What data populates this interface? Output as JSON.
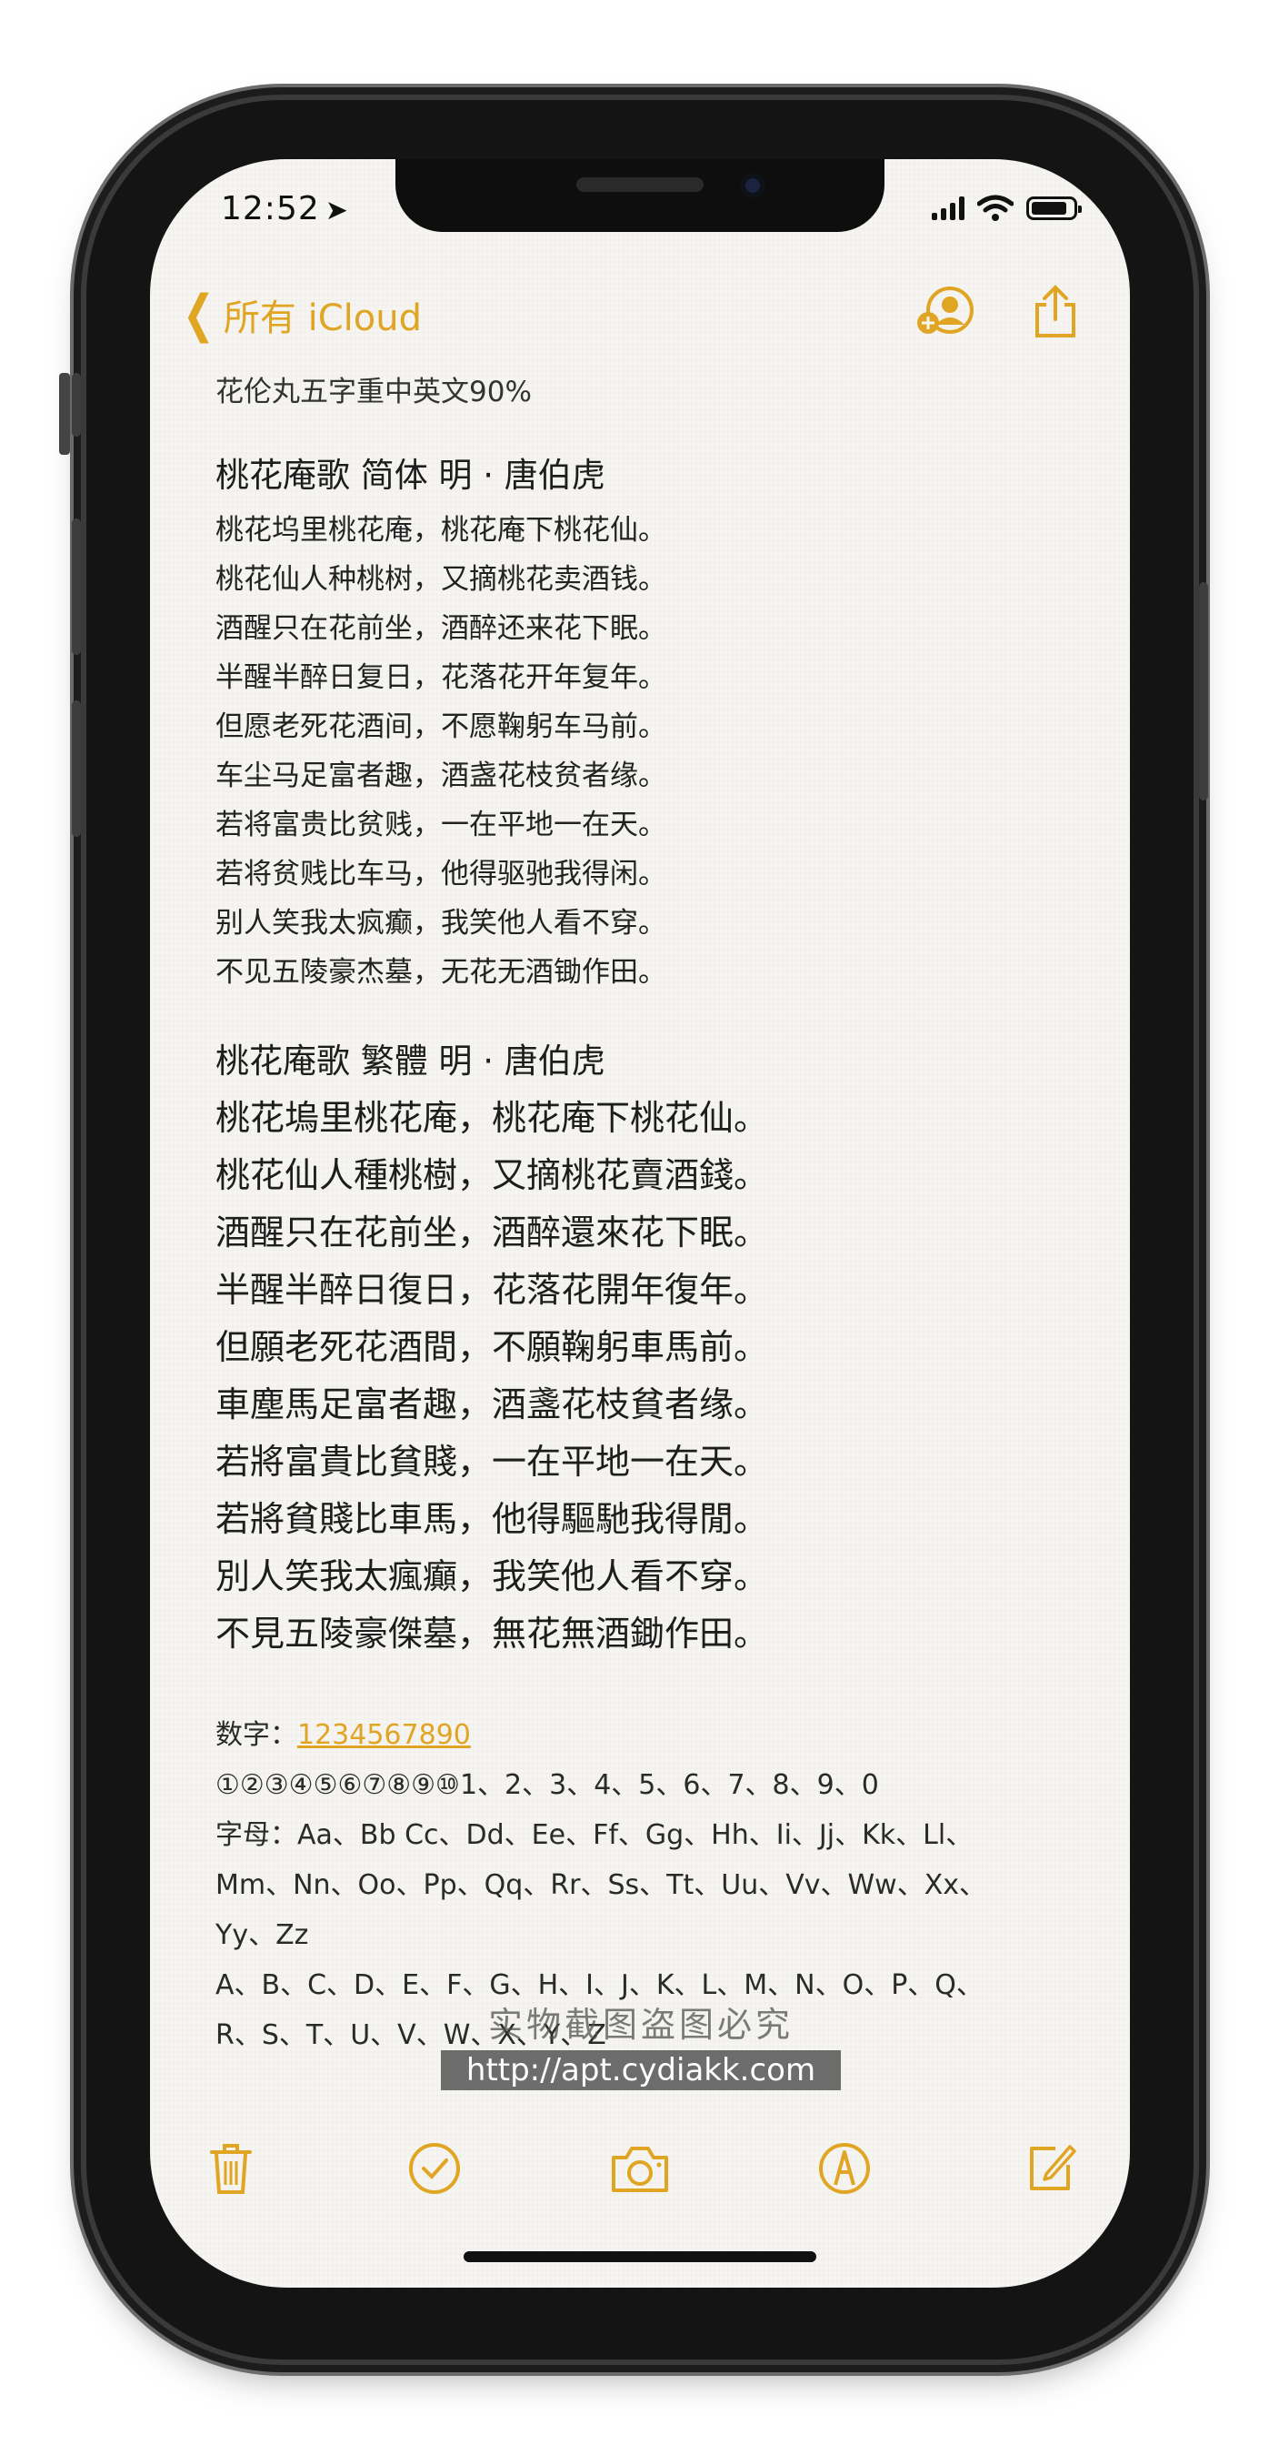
{
  "status_bar": {
    "time": "12:52",
    "location_arrow": "location-arrow-icon"
  },
  "nav": {
    "back_label": "所有 iCloud",
    "icons": [
      "add-person-icon",
      "share-icon"
    ]
  },
  "note": {
    "subtitle": "花伦丸五字重中英文90%",
    "poem_simplified": {
      "title": "桃花庵歌  简体   明 · 唐伯虎",
      "lines": [
        "桃花坞里桃花庵，桃花庵下桃花仙。",
        "桃花仙人种桃树，又摘桃花卖酒钱。",
        "酒醒只在花前坐，酒醉还来花下眠。",
        "半醒半醉日复日，花落花开年复年。",
        "但愿老死花酒间，不愿鞠躬车马前。",
        "车尘马足富者趣，酒盏花枝贫者缘。",
        "若将富贵比贫贱，一在平地一在天。",
        "若将贫贱比车马，他得驱驰我得闲。",
        "别人笑我太疯癫，我笑他人看不穿。",
        "不见五陵豪杰墓，无花无酒锄作田。"
      ]
    },
    "poem_traditional": {
      "title": "桃花庵歌  繁體      明 · 唐伯虎",
      "lines": [
        "桃花塢里桃花庵，桃花庵下桃花仙。",
        "桃花仙人種桃樹，又摘桃花賣酒錢。",
        "酒醒只在花前坐，酒醉還來花下眠。",
        "半醒半醉日復日，花落花開年復年。",
        "但願老死花酒間，不願鞠躬車馬前。",
        "車塵馬足富者趣，酒盞花枝貧者缘。",
        "若將富貴比貧賤，一在平地一在天。",
        "若將貧賤比車馬，他得驅馳我得閒。",
        "別人笑我太瘋癲，我笑他人看不穿。",
        "不見五陵豪傑墓，無花無酒鋤作田。"
      ]
    },
    "numbers_label": "数字：",
    "numbers_link": "1234567890",
    "numbers_line": "①②③④⑤⑥⑦⑧⑨⑩1、2、3、4、5、6、7、8、9、0",
    "letters": [
      "字母：Aa、Bb Cc、Dd、Ee、Ff、Gg、Hh、Ii、Jj、Kk、Ll、",
      "Mm、Nn、Oo、Pp、Qq、Rr、Ss、Tt、Uu、Vv、Ww、Xx、",
      "Yy、Zz",
      "A、B、C、D、E、F、G、H、I、J、K、L、M、N、O、P、Q、",
      "R、S、T、U、V、W、X、Y、Z"
    ]
  },
  "watermark": {
    "top": "实物截图盗图必究",
    "bottom": "http://apt.cydiakk.com"
  },
  "toolbar": {
    "icons": [
      "trash-icon",
      "checklist-icon",
      "camera-icon",
      "markup-icon",
      "compose-icon"
    ]
  },
  "colors": {
    "accent": "#e0a523",
    "text": "#222222",
    "paper": "#f6f5f2"
  }
}
